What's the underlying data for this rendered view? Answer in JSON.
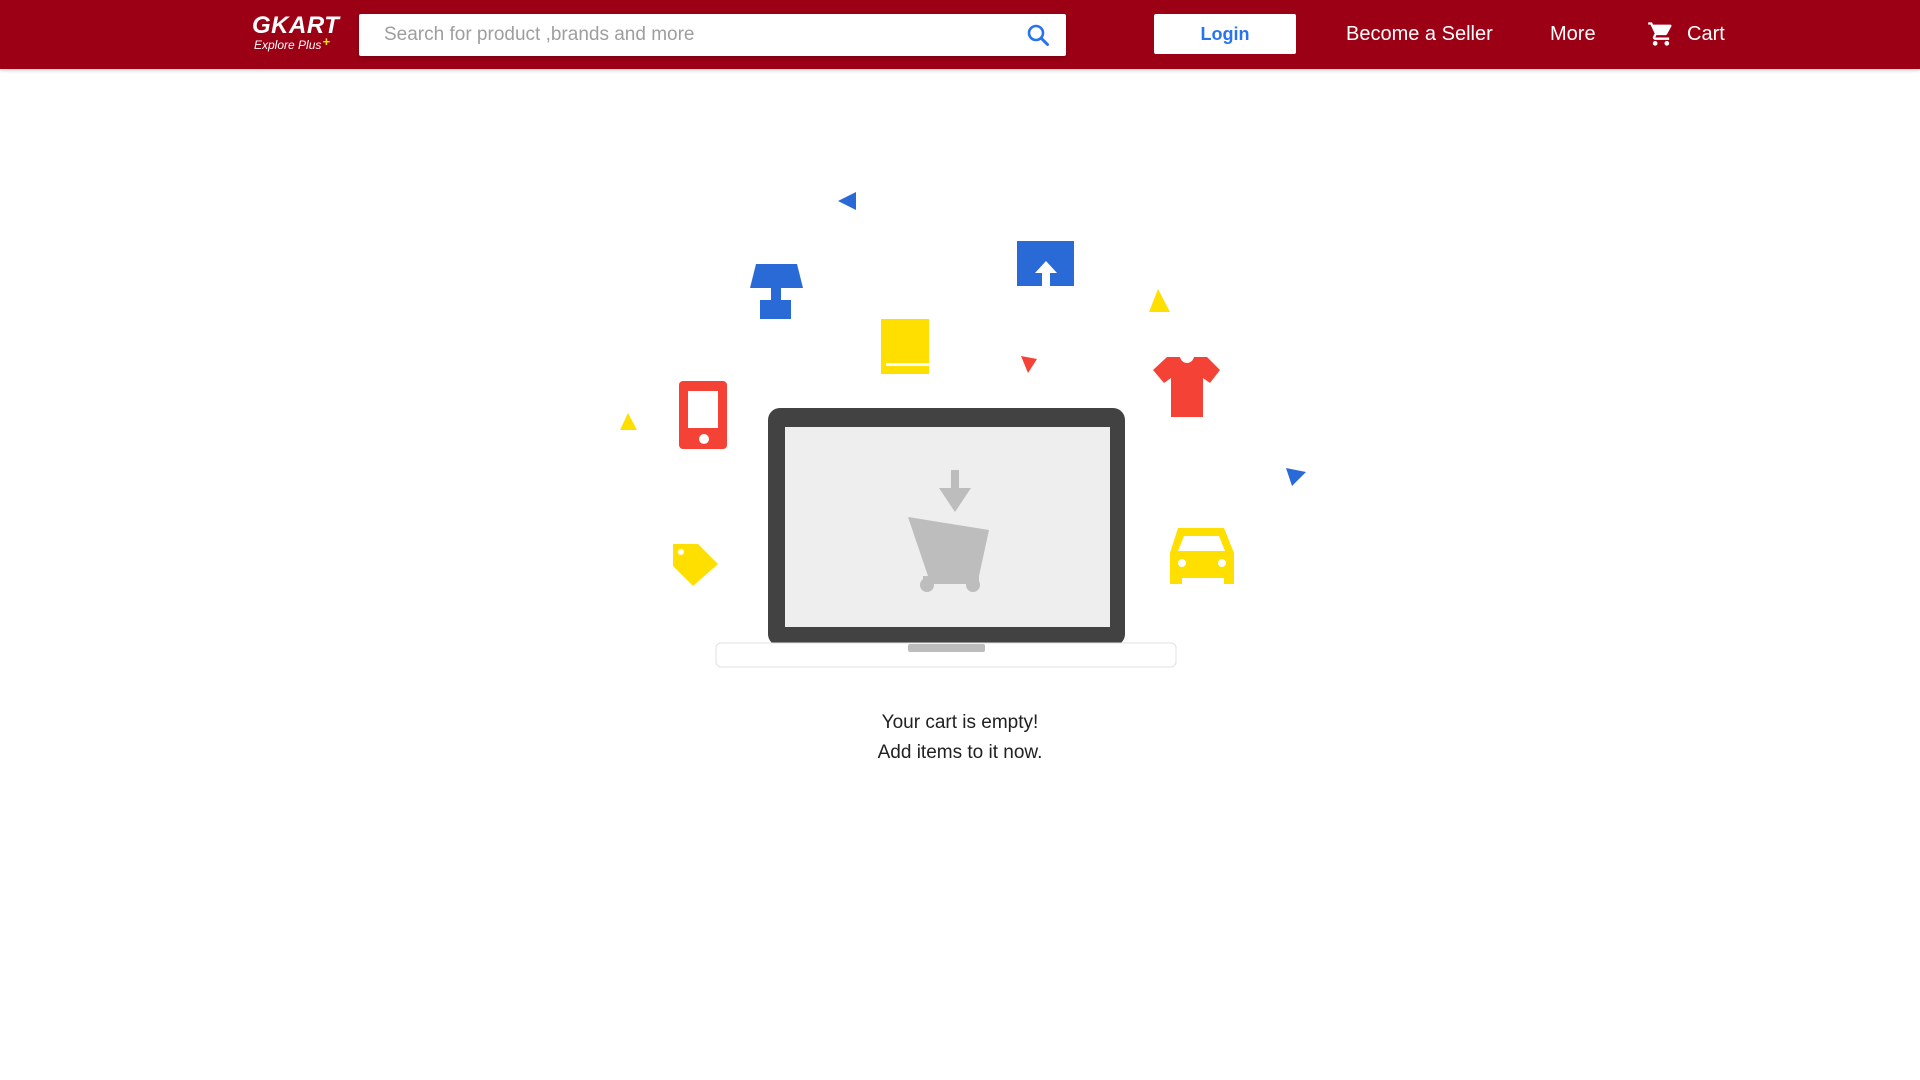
{
  "header": {
    "logo": {
      "title": "GKART",
      "subtitle": "Explore",
      "subtitle_plus": "Plus",
      "plus_symbol": "+"
    },
    "search": {
      "placeholder": "Search for product ,brands and more",
      "value": "",
      "icon": "search-icon"
    },
    "login_label": "Login",
    "seller_label": "Become a Seller",
    "more_label": "More",
    "cart": {
      "label": "Cart",
      "icon": "cart-icon"
    }
  },
  "empty_cart": {
    "line1": "Your cart is empty!",
    "line2": "Add items to it now.",
    "illustration_icons": [
      "lamp-icon",
      "book-icon",
      "upload-box-icon",
      "phone-icon",
      "shirt-icon",
      "tag-icon",
      "car-icon",
      "laptop-icon",
      "cart-download-icon"
    ]
  },
  "colors": {
    "header_bg": "#9b0014",
    "login_text": "#2874f0",
    "accent_yellow": "#ffe11b",
    "blue_icon": "#2a6ad6",
    "red_icon": "#f44336",
    "yellow_icon": "#ffdf00"
  }
}
